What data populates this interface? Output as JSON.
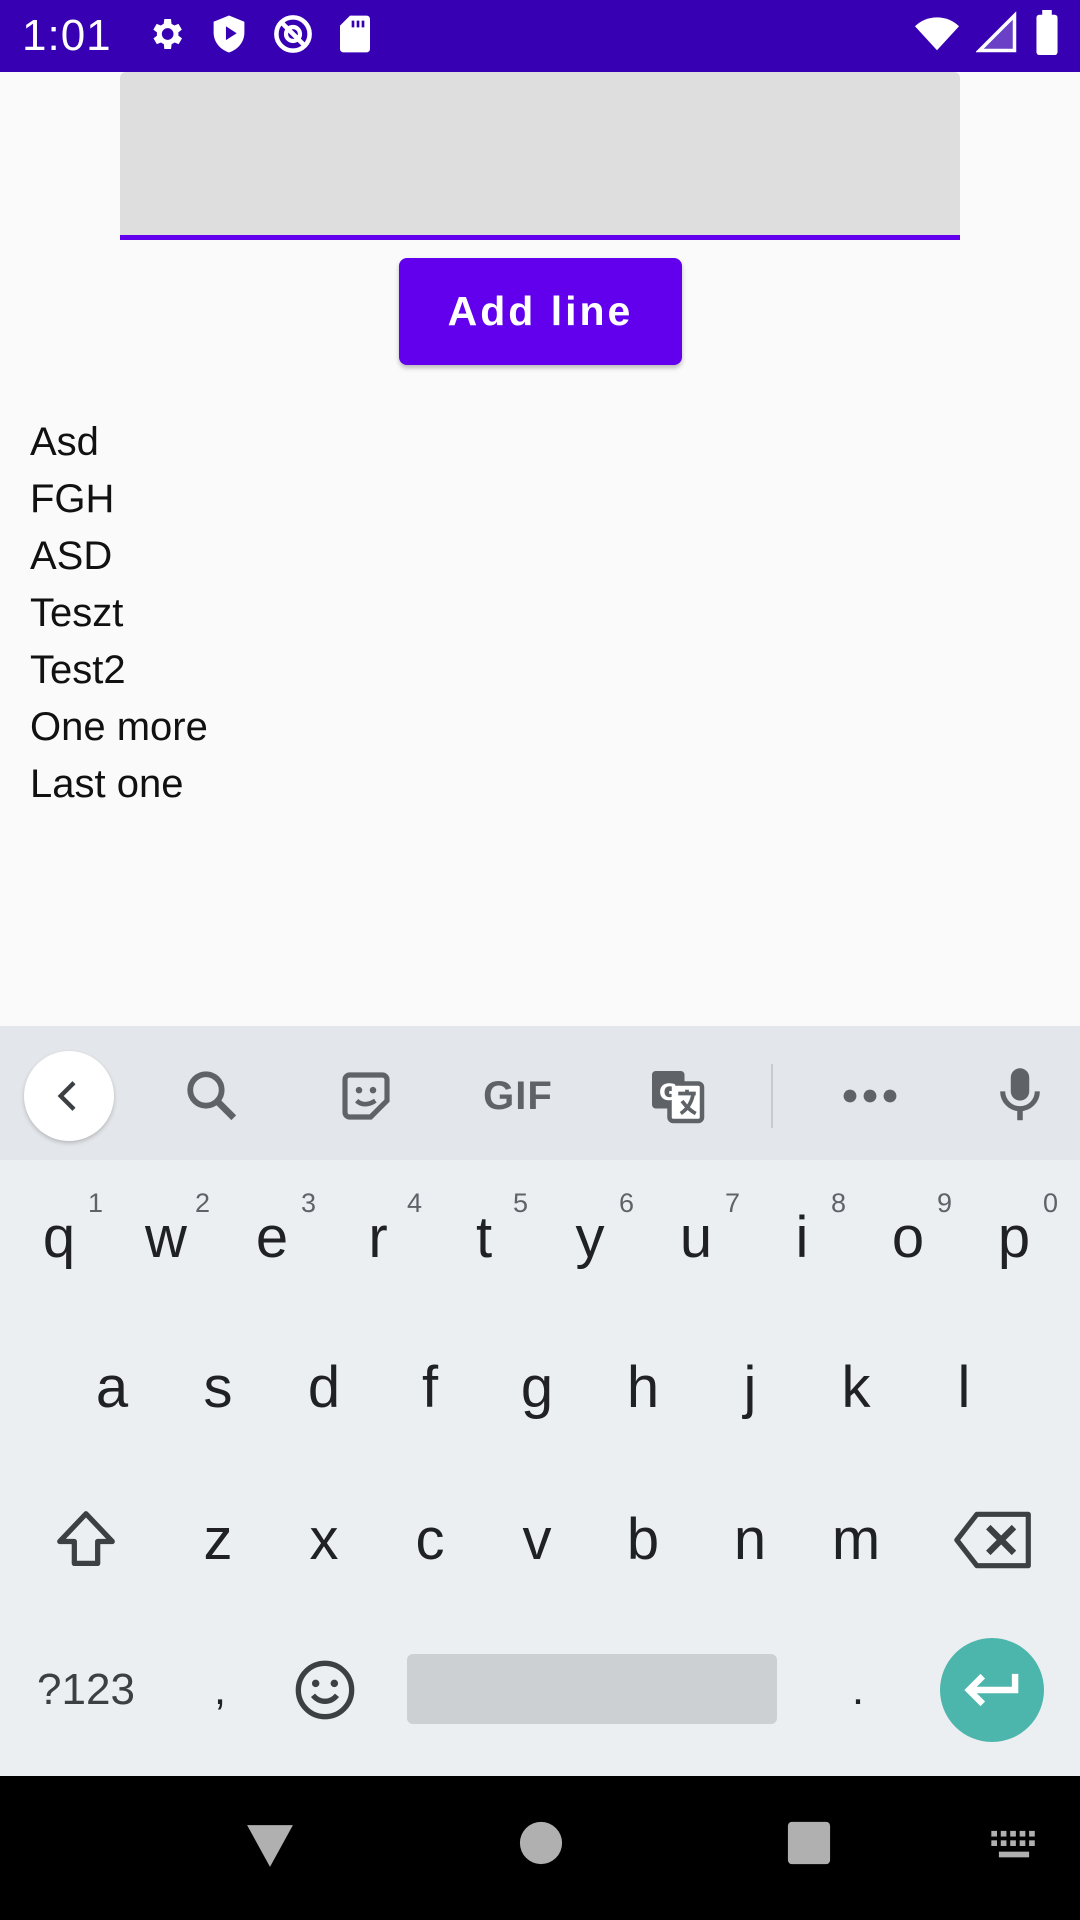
{
  "status_bar": {
    "time": "1:01",
    "left_icons": [
      "settings-icon",
      "play-protect-icon",
      "no-disturb-icon",
      "sd-card-icon"
    ],
    "right_icons": [
      "wifi-icon",
      "signal-icon",
      "battery-icon"
    ],
    "background": "#3700b3"
  },
  "form": {
    "input_value": "",
    "add_button_label": "Add line",
    "accent": "#6200ee"
  },
  "lines": [
    "Asd",
    "FGH",
    "ASD",
    "Teszt",
    "Test2",
    "One more",
    "Last one"
  ],
  "keyboard": {
    "toolbar_icons": [
      "back-icon",
      "search-icon",
      "sticker-icon",
      "gif-icon",
      "translate-icon",
      "more-icon",
      "mic-icon"
    ],
    "gif_label": "GIF",
    "row1": [
      {
        "key": "q",
        "hint": "1"
      },
      {
        "key": "w",
        "hint": "2"
      },
      {
        "key": "e",
        "hint": "3"
      },
      {
        "key": "r",
        "hint": "4"
      },
      {
        "key": "t",
        "hint": "5"
      },
      {
        "key": "y",
        "hint": "6"
      },
      {
        "key": "u",
        "hint": "7"
      },
      {
        "key": "i",
        "hint": "8"
      },
      {
        "key": "o",
        "hint": "9"
      },
      {
        "key": "p",
        "hint": "0"
      }
    ],
    "row2": [
      "a",
      "s",
      "d",
      "f",
      "g",
      "h",
      "j",
      "k",
      "l"
    ],
    "row3": [
      "z",
      "x",
      "c",
      "v",
      "b",
      "n",
      "m"
    ],
    "symbols_label": "?123",
    "comma": ",",
    "period": ".",
    "enter_color": "#4db6ac"
  },
  "nav_bar": {
    "buttons": [
      "back-nav-icon",
      "home-nav-icon",
      "recents-nav-icon",
      "keyboard-switch-icon"
    ]
  }
}
